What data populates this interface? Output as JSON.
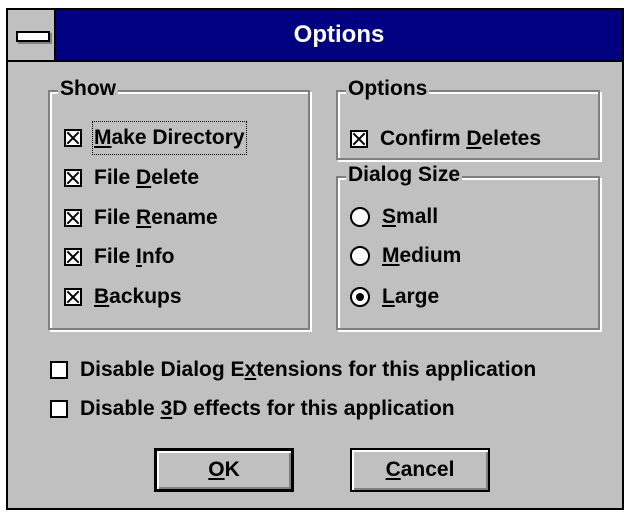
{
  "window": {
    "title": "Options"
  },
  "show_group": {
    "label": "Show",
    "items": [
      {
        "label": "Make Directory",
        "ul": "M",
        "rest": "ake Directory",
        "checked": true
      },
      {
        "label": "File Delete",
        "pre": "File ",
        "ul": "D",
        "rest": "elete",
        "checked": true
      },
      {
        "label": "File Rename",
        "pre": "File ",
        "ul": "R",
        "rest": "ename",
        "checked": true
      },
      {
        "label": "File Info",
        "pre": "File ",
        "ul": "I",
        "rest": "nfo",
        "checked": true
      },
      {
        "label": "Backups",
        "ul": "B",
        "rest": "ackups",
        "checked": true
      }
    ]
  },
  "options_group": {
    "label": "Options",
    "confirm_deletes": {
      "pre": "Confirm ",
      "ul": "D",
      "rest": "eletes",
      "checked": true
    }
  },
  "dialog_size_group": {
    "label": "Dialog Size",
    "options": [
      {
        "ul": "S",
        "rest": "mall",
        "selected": false
      },
      {
        "ul": "M",
        "rest": "edium",
        "selected": false
      },
      {
        "ul": "L",
        "rest": "arge",
        "selected": true
      }
    ]
  },
  "extra": {
    "disable_extensions": {
      "pre": "Disable Dialog E",
      "ul": "x",
      "rest": "tensions for this application",
      "checked": false
    },
    "disable_3d": {
      "pre": "Disable ",
      "ul": "3",
      "rest": "D effects for this application",
      "checked": false
    }
  },
  "buttons": {
    "ok": {
      "ul": "O",
      "rest": "K"
    },
    "cancel": {
      "ul": "C",
      "rest": "ancel"
    }
  }
}
